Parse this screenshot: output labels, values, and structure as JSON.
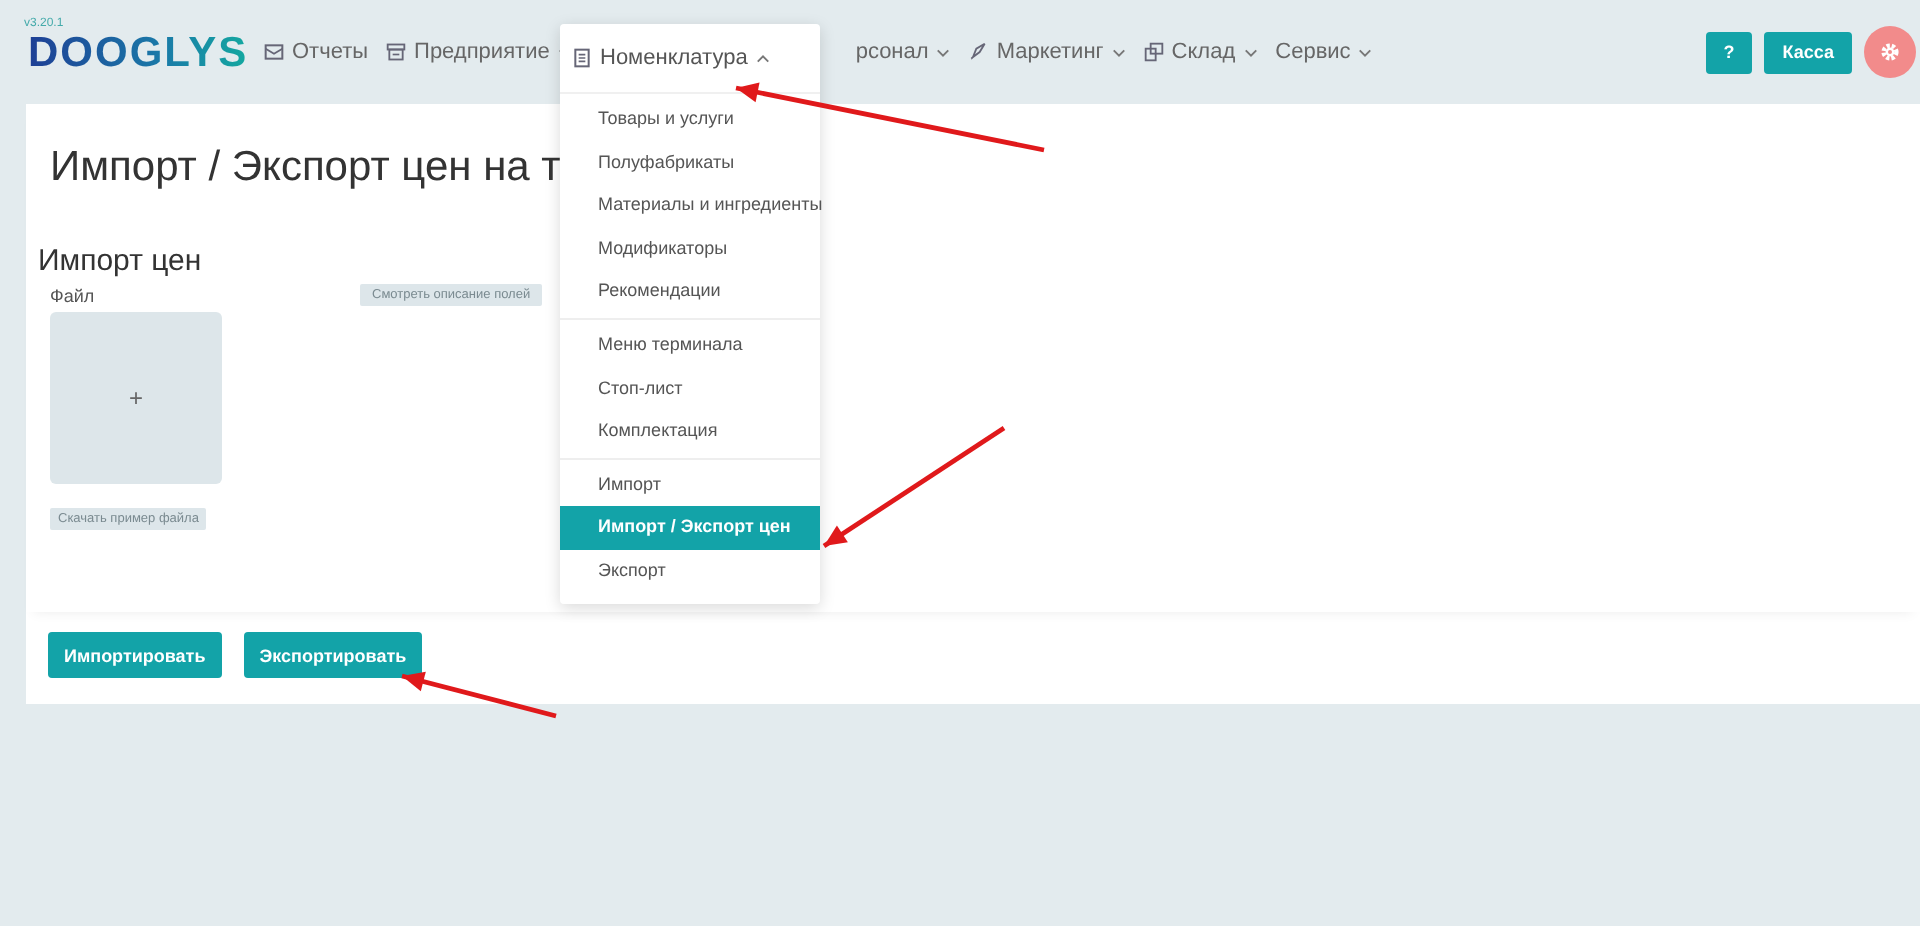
{
  "header": {
    "version": "v3.20.1",
    "logo": "DOOGLYS",
    "nav": [
      {
        "label": "Отчеты",
        "caret": false,
        "expanded": false
      },
      {
        "label": "Предприятие",
        "caret": true,
        "expanded": false
      },
      {
        "label": "Номенклатура",
        "caret": true,
        "expanded": true
      },
      {
        "label": "рсонал",
        "caret": true,
        "expanded": false
      },
      {
        "label": "Маркетинг",
        "caret": true,
        "expanded": false
      },
      {
        "label": "Склад",
        "caret": true,
        "expanded": false
      },
      {
        "label": "Сервис",
        "caret": true,
        "expanded": false
      }
    ],
    "help_button": "?",
    "cashier_button": "Касса"
  },
  "menu": {
    "groups": [
      [
        {
          "label": "Товары и услуги",
          "selected": false
        },
        {
          "label": "Полуфабрикаты",
          "selected": false
        },
        {
          "label": "Материалы и ингредиенты",
          "selected": false
        },
        {
          "label": "Модификаторы",
          "selected": false
        },
        {
          "label": "Рекомендации",
          "selected": false
        }
      ],
      [
        {
          "label": "Меню терминала",
          "selected": false
        },
        {
          "label": "Стоп-лист",
          "selected": false
        },
        {
          "label": "Комплектация",
          "selected": false
        }
      ],
      [
        {
          "label": "Импорт",
          "selected": false
        },
        {
          "label": "Импорт / Экспорт цен",
          "selected": true
        },
        {
          "label": "Экспорт",
          "selected": false
        }
      ]
    ]
  },
  "page": {
    "title": "Импорт / Экспорт цен на т",
    "section": "Импорт цен",
    "file_label": "Файл",
    "fields_button": "Смотреть описание полей",
    "upload_plus": "+",
    "sample_button": "Скачать пример файла",
    "actions": [
      "Импортировать",
      "Экспортировать"
    ]
  },
  "annotations": [
    {
      "kind": "arrow"
    },
    {
      "kind": "arrow"
    },
    {
      "kind": "arrow"
    }
  ]
}
